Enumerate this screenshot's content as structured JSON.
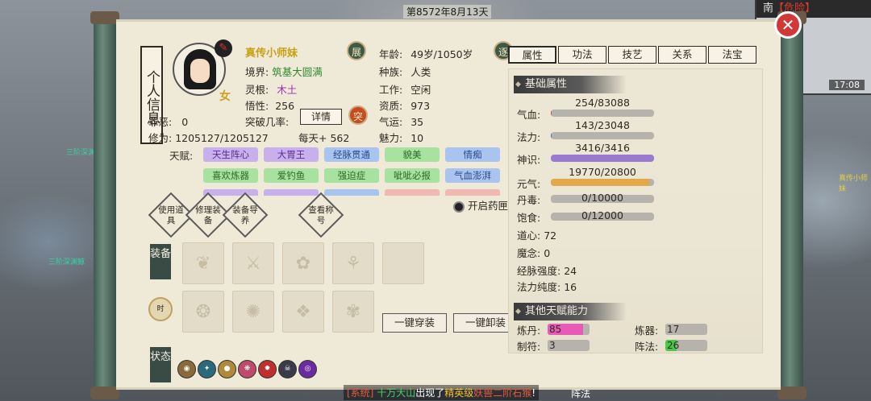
{
  "topbar": {
    "date": "第8572年8月13天"
  },
  "minimap": {
    "location": "南",
    "danger": "【危险】",
    "time": "17:08"
  },
  "close_icon": "✕",
  "arrows": {
    "left": "❮",
    "right": "❯"
  },
  "panel_title": "个人信息",
  "character": {
    "name": "真传小师妹",
    "gender": "女",
    "brush_icon": "✎",
    "realm_label": "境界:",
    "realm": "筑基大圆满",
    "root_label": "灵根:",
    "root": "木土",
    "insight_label": "悟性:",
    "insight": "256",
    "breakthrough_label": "突破几率:",
    "detail_btn": "详情",
    "sin_label": "罪恶:",
    "sin": "0",
    "cultivation_label": "修为:",
    "cultivation": "1205127/1205127",
    "daily": "每天+ 562",
    "age_label": "年龄:",
    "age": "49岁/1050岁",
    "race_label": "种族:",
    "race": "人类",
    "job_label": "工作:",
    "job": "空闲",
    "aptitude_label": "资质:",
    "aptitude": "973",
    "luck_label": "气运:",
    "luck": "35",
    "charm_label": "魅力:",
    "charm": "10",
    "badges": {
      "zhan": "展",
      "zhu": "逐",
      "tu": "突"
    }
  },
  "talents": {
    "label": "天赋:",
    "items": [
      {
        "name": "天生阵心",
        "color": "purple"
      },
      {
        "name": "大胃王",
        "color": "purple"
      },
      {
        "name": "经脉贯通",
        "color": "blue"
      },
      {
        "name": "貌美",
        "color": "green"
      },
      {
        "name": "情痴",
        "color": "blue"
      },
      {
        "name": "喜欢炼器",
        "color": "green"
      },
      {
        "name": "爱钓鱼",
        "color": "green"
      },
      {
        "name": "强迫症",
        "color": "green"
      },
      {
        "name": "呲呲必报",
        "color": "green"
      },
      {
        "name": "气血澎湃",
        "color": "blue"
      }
    ],
    "partial_row": [
      {
        "name": "",
        "color": "purple"
      },
      {
        "name": "",
        "color": "purple"
      },
      {
        "name": "",
        "color": "blue"
      },
      {
        "name": "",
        "color": "red"
      },
      {
        "name": "",
        "color": "red"
      }
    ]
  },
  "actions": {
    "use_item": "使用道具",
    "repair": "修理装备",
    "equip_skill": "装备导养",
    "view_tech": "查看称号",
    "herb_toggle": "开启药匣"
  },
  "equipment": {
    "label": "装备",
    "slot_glyphs": [
      "❦",
      "⚔",
      "✿",
      "⚘",
      "",
      "❂",
      "✺",
      "❖",
      "✾",
      ""
    ],
    "wear_all": "一键穿装",
    "remove_all": "一键卸装",
    "clock_label": "时"
  },
  "status": {
    "label": "状态",
    "icons": [
      {
        "glyph": "◉",
        "color": "#8a6a3a"
      },
      {
        "glyph": "✦",
        "color": "#2a6a7a"
      },
      {
        "glyph": "●",
        "color": "#b08a3a"
      },
      {
        "glyph": "❋",
        "color": "#c04a6a"
      },
      {
        "glyph": "✹",
        "color": "#c03030"
      },
      {
        "glyph": "☠",
        "color": "#3a3a4a"
      },
      {
        "glyph": "◎",
        "color": "#6a2aa0"
      }
    ]
  },
  "tabs": [
    "属性",
    "功法",
    "技艺",
    "关系",
    "法宝"
  ],
  "basic_attrs": {
    "heading": "基础属性",
    "hp_label": "气血:",
    "hp": "254/83088",
    "hp_ratio": 0.003,
    "hp_color": "#c85050",
    "mp_label": "法力:",
    "mp": "143/23048",
    "mp_ratio": 0.006,
    "mp_color": "#4a70c8",
    "spirit_label": "神识:",
    "spirit": "3416/3416",
    "spirit_ratio": 1.0,
    "spirit_color": "#9a7ad0",
    "yuanqi_label": "元气:",
    "yuanqi": "19770/20800",
    "yuanqi_ratio": 0.95,
    "yuanqi_color": "#e2a84a",
    "poison_label": "丹毒:",
    "poison": "0/10000",
    "poison_ratio": 0,
    "poison_color": "#6aa06a",
    "food_label": "饱食:",
    "food": "0/12000",
    "food_ratio": 0,
    "food_color": "#c8a060",
    "dao_label": "道心:",
    "dao": "72",
    "mo_label": "魔念:",
    "mo": "0",
    "meridian_label": "经脉强度:",
    "meridian": "24",
    "purity_label": "法力纯度:",
    "purity": "16"
  },
  "other_talents": {
    "heading": "其他天赋能力",
    "alchemy_label": "炼丹:",
    "alchemy": "85",
    "alchemy_color": "#e85ab8",
    "forging_label": "炼器:",
    "forging": "17",
    "forging_color": "#b6b2ac",
    "talisman_label": "制符:",
    "talisman": "3",
    "talisman_color": "#b6b2ac",
    "array_label": "阵法:",
    "array": "26",
    "array_color": "#4ac84a"
  },
  "system_message": {
    "tag": "[系统]",
    "place": "十万大山",
    "mid": "出现了",
    "elite": "精英级",
    "beast": "妖兽二阶石猴",
    "end": "!"
  },
  "map_labels": {
    "npc_left1": "三阶深渊鲸",
    "npc_left2": "三阶深渊鲸",
    "npc_right": "真传小师妹",
    "bottom": "阵法"
  }
}
